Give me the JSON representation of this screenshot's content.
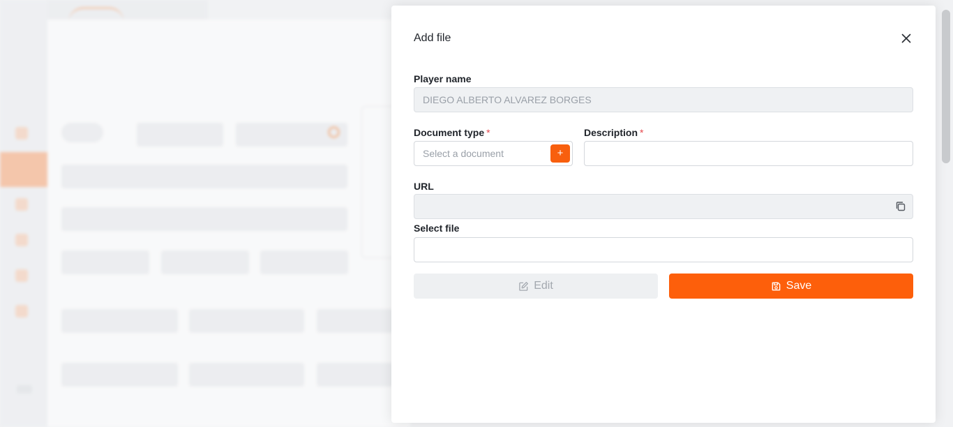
{
  "modal": {
    "title": "Add file",
    "player_name_label": "Player name",
    "player_name_value": "DIEGO ALBERTO ALVAREZ BORGES",
    "document_type_label": "Document type",
    "document_type_placeholder": "Select a document",
    "description_label": "Description",
    "description_value": "",
    "url_label": "URL",
    "url_value": "",
    "select_file_label": "Select file",
    "select_file_value": "",
    "required_mark": "*",
    "add_document_button": "+",
    "edit_button": "Edit",
    "save_button": "Save"
  },
  "icons": {
    "close": "close-icon",
    "copy": "copy-icon",
    "edit": "pencil-icon",
    "save": "floppy-disk-icon"
  },
  "colors": {
    "accent": "#fd5f0b",
    "required": "#e5484d",
    "disabled_bg": "#eff1f3"
  }
}
